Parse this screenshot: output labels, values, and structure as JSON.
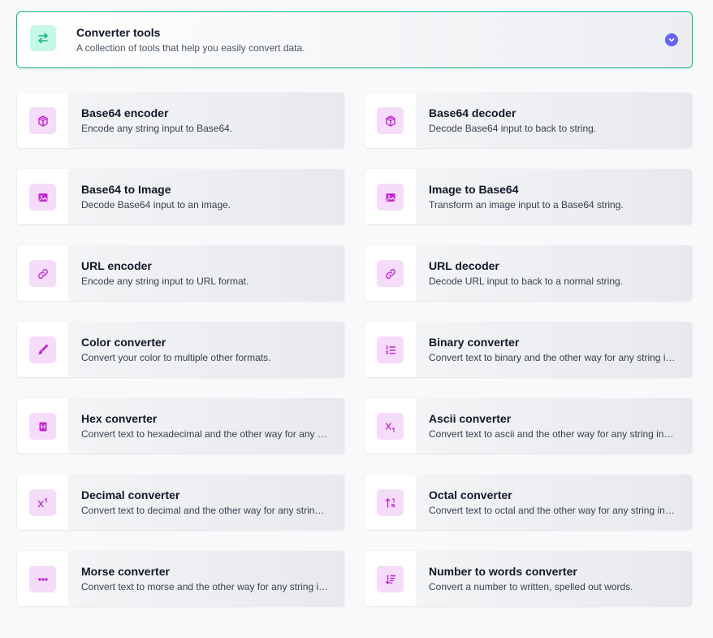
{
  "colors": {
    "accent_green": "#10b981",
    "toggle_indigo": "#6366f1",
    "icon_magenta": "#c026d3",
    "icon_bg_pink": "#f5dcf8"
  },
  "header": {
    "icon": "arrows-exchange-icon",
    "title": "Converter tools",
    "description": "A collection of tools that help you easily convert data.",
    "toggle_icon": "chevron-down-icon"
  },
  "tools": [
    {
      "icon": "codesandbox-icon",
      "title": "Base64 encoder",
      "description": "Encode any string input to Base64."
    },
    {
      "icon": "codesandbox-icon",
      "title": "Base64 decoder",
      "description": "Decode Base64 input to back to string."
    },
    {
      "icon": "image-icon",
      "title": "Base64 to Image",
      "description": "Decode Base64 input to an image."
    },
    {
      "icon": "image-icon",
      "title": "Image to Base64",
      "description": "Transform an image input to a Base64 string."
    },
    {
      "icon": "link-icon",
      "title": "URL encoder",
      "description": "Encode any string input to URL format."
    },
    {
      "icon": "link-icon",
      "title": "URL decoder",
      "description": "Decode URL input to back to a normal string."
    },
    {
      "icon": "paintbrush-icon",
      "title": "Color converter",
      "description": "Convert your color to multiple other formats."
    },
    {
      "icon": "list-ordered-icon",
      "title": "Binary converter",
      "description": "Convert text to binary and the other way for any string input."
    },
    {
      "icon": "calculator-icon",
      "title": "Hex converter",
      "description": "Convert text to hexadecimal and the other way for any string input."
    },
    {
      "icon": "subscript-icon",
      "title": "Ascii converter",
      "description": "Convert text to ascii and the other way for any string input."
    },
    {
      "icon": "superscript-icon",
      "title": "Decimal converter",
      "description": "Convert text to decimal and the other way for any string input."
    },
    {
      "icon": "sort-numeric-icon",
      "title": "Octal converter",
      "description": "Convert text to octal and the other way for any string input."
    },
    {
      "icon": "dots-icon",
      "title": "Morse converter",
      "description": "Convert text to morse and the other way for any string input."
    },
    {
      "icon": "sort-descending-icon",
      "title": "Number to words converter",
      "description": "Convert a number to written, spelled out words."
    }
  ]
}
